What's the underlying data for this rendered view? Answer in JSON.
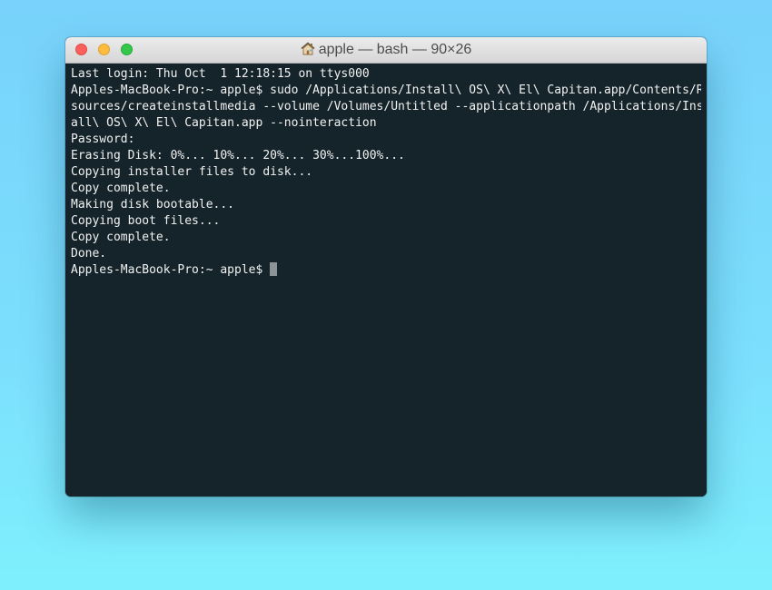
{
  "window": {
    "title": "apple — bash — 90×26",
    "title_icon": "home-icon",
    "colors": {
      "terminal_bg": "#15242a",
      "terminal_fg": "#f2f2f2",
      "close": "#fc605c",
      "minimize": "#fdbc40",
      "zoom": "#34c84a"
    }
  },
  "terminal": {
    "lines": [
      "Last login: Thu Oct  1 12:18:15 on ttys000",
      "Apples-MacBook-Pro:~ apple$ sudo /Applications/Install\\ OS\\ X\\ El\\ Capitan.app/Contents/Re",
      "sources/createinstallmedia --volume /Volumes/Untitled --applicationpath /Applications/Inst",
      "all\\ OS\\ X\\ El\\ Capitan.app --nointeraction",
      "Password:",
      "Erasing Disk: 0%... 10%... 20%... 30%...100%...",
      "Copying installer files to disk...",
      "Copy complete.",
      "Making disk bootable...",
      "Copying boot files...",
      "Copy complete.",
      "Done."
    ],
    "prompt": "Apples-MacBook-Pro:~ apple$ "
  }
}
